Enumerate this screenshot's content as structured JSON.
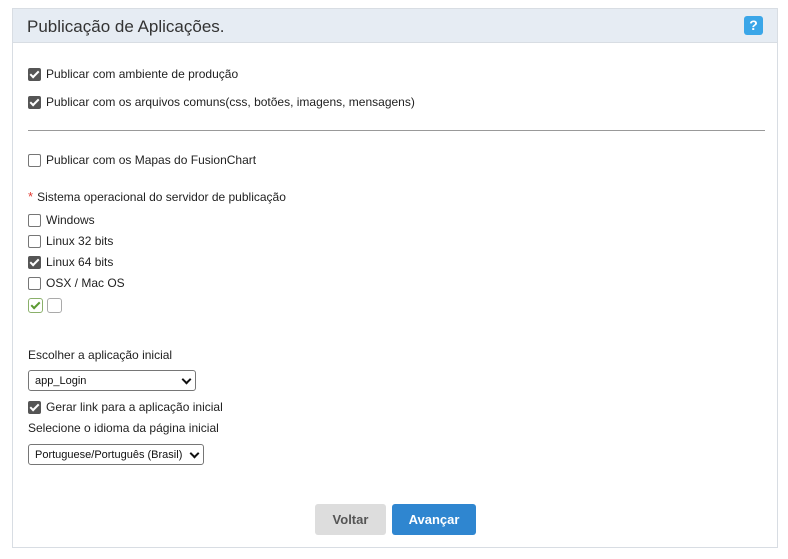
{
  "header": {
    "title": "Publicação de Aplicações.",
    "help_label": "?"
  },
  "options": {
    "producao": {
      "label": "Publicar com ambiente de produção",
      "checked": true
    },
    "comuns": {
      "label": "Publicar com os arquivos comuns(css, botões, imagens, mensagens)",
      "checked": true
    },
    "fusion": {
      "label": "Publicar com os Mapas do FusionChart",
      "checked": false
    }
  },
  "os_section": {
    "required_mark": "*",
    "label": "Sistema operacional do servidor de publicação",
    "items": [
      {
        "label": "Windows",
        "checked": false
      },
      {
        "label": "Linux 32 bits",
        "checked": false
      },
      {
        "label": "Linux 64 bits",
        "checked": true
      },
      {
        "label": "OSX / Mac OS",
        "checked": false
      }
    ]
  },
  "initial_app": {
    "label": "Escolher a aplicação inicial",
    "selected": "app_Login",
    "gen_link": {
      "label": "Gerar link para a aplicação inicial",
      "checked": true
    }
  },
  "language": {
    "label": "Selecione o idioma da página inicial",
    "selected": "Portuguese/Português (Brasil)"
  },
  "buttons": {
    "back": "Voltar",
    "next": "Avançar"
  },
  "colors": {
    "primary": "#2f86d0",
    "help": "#3aa6e8",
    "header_bg": "#e6ecf3"
  }
}
